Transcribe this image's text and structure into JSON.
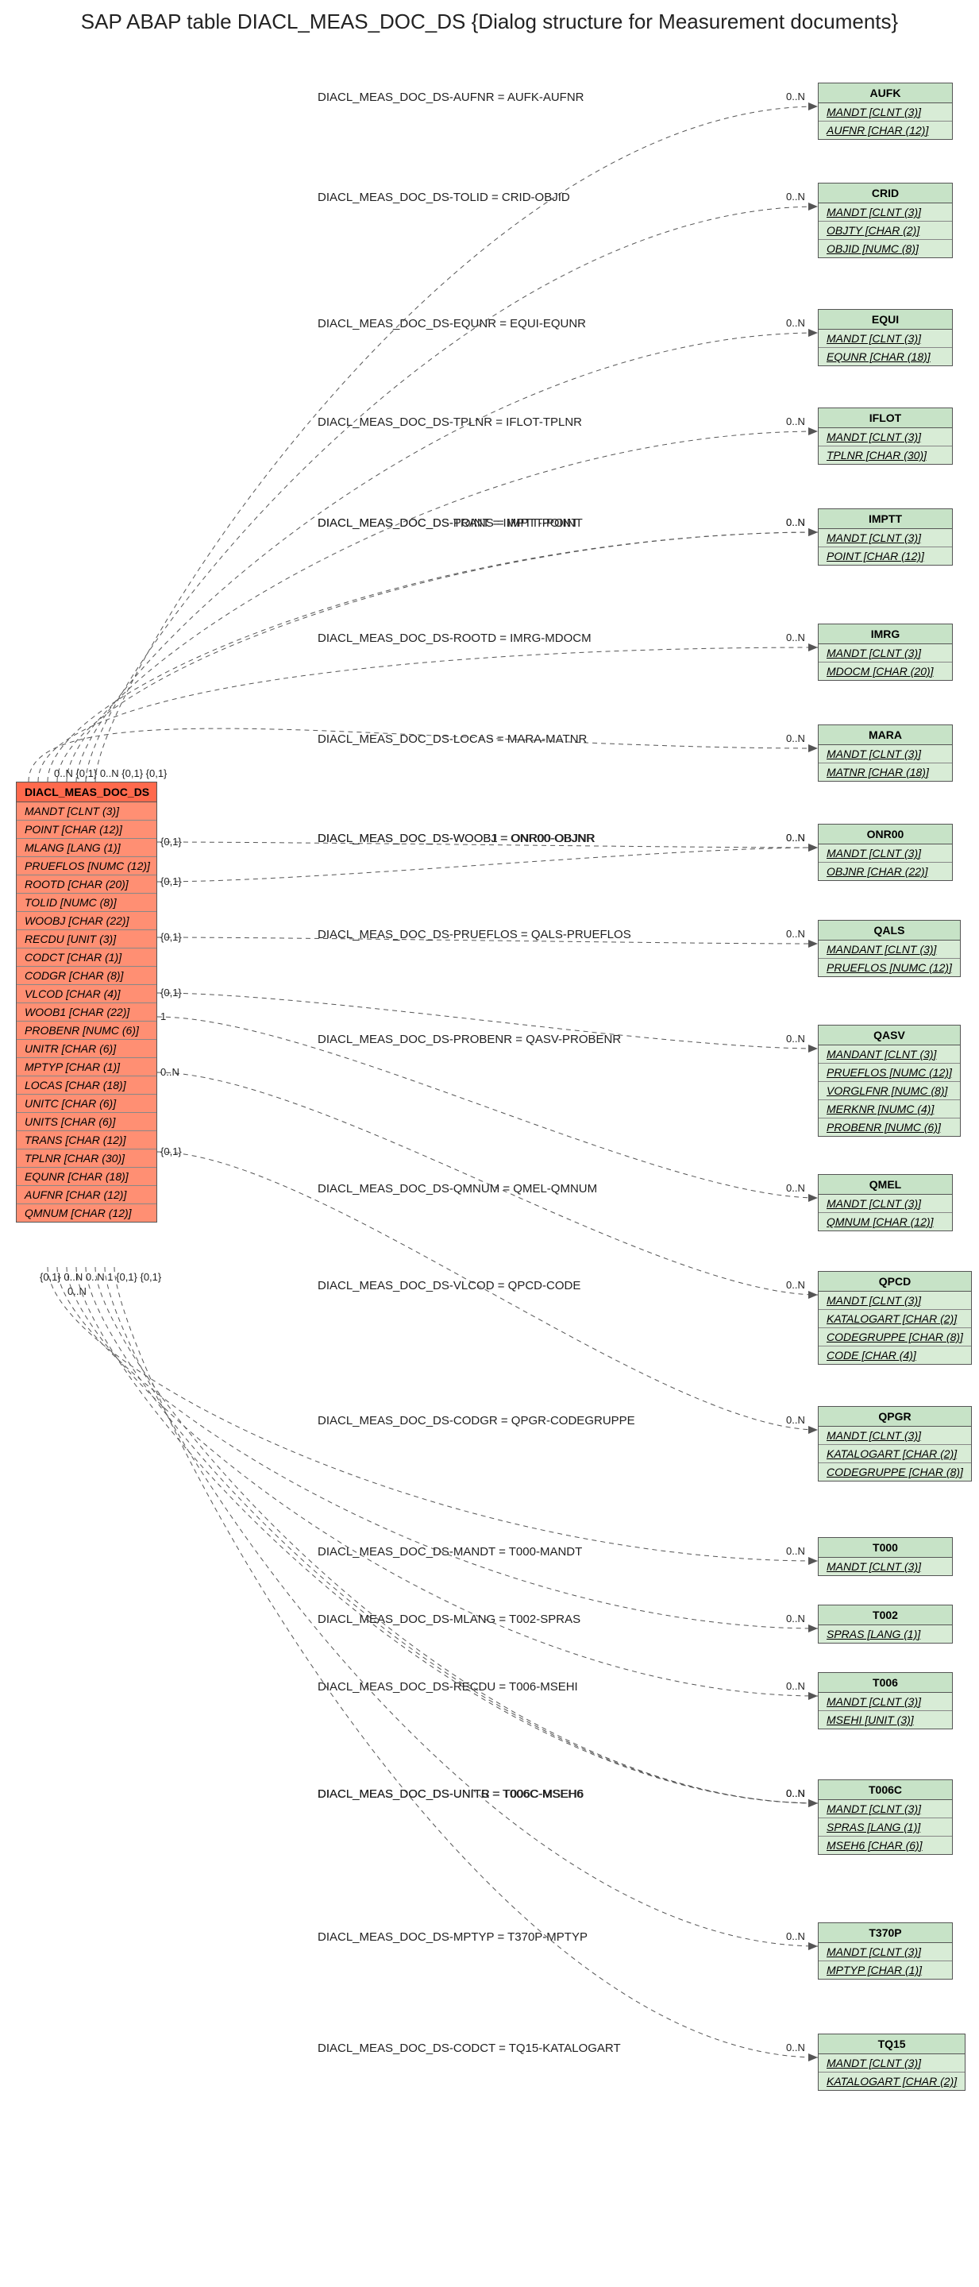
{
  "title": "SAP ABAP table DIACL_MEAS_DOC_DS {Dialog structure for Measurement documents}",
  "main": {
    "name": "DIACL_MEAS_DOC_DS",
    "fields": [
      "MANDT [CLNT (3)]",
      "POINT [CHAR (12)]",
      "MLANG [LANG (1)]",
      "PRUEFLOS [NUMC (12)]",
      "ROOTD [CHAR (20)]",
      "TOLID [NUMC (8)]",
      "WOOBJ [CHAR (22)]",
      "RECDU [UNIT (3)]",
      "CODCT [CHAR (1)]",
      "CODGR [CHAR (8)]",
      "VLCOD [CHAR (4)]",
      "WOOB1 [CHAR (22)]",
      "PROBENR [NUMC (6)]",
      "UNITR [CHAR (6)]",
      "MPTYP [CHAR (1)]",
      "LOCAS [CHAR (18)]",
      "UNITC [CHAR (6)]",
      "UNITS [CHAR (6)]",
      "TRANS [CHAR (12)]",
      "TPLNR [CHAR (30)]",
      "EQUNR [CHAR (18)]",
      "AUFNR [CHAR (12)]",
      "QMNUM [CHAR (12)]"
    ]
  },
  "targets": [
    {
      "name": "AUFK",
      "fields": [
        {
          "t": "MANDT [CLNT (3)]",
          "u": true
        },
        {
          "t": "AUFNR [CHAR (12)]",
          "u": true
        }
      ]
    },
    {
      "name": "CRID",
      "fields": [
        {
          "t": "MANDT [CLNT (3)]",
          "u": true
        },
        {
          "t": "OBJTY [CHAR (2)]",
          "u": true
        },
        {
          "t": "OBJID [NUMC (8)]",
          "u": true
        }
      ]
    },
    {
      "name": "EQUI",
      "fields": [
        {
          "t": "MANDT [CLNT (3)]",
          "u": true
        },
        {
          "t": "EQUNR [CHAR (18)]",
          "u": true
        }
      ]
    },
    {
      "name": "IFLOT",
      "fields": [
        {
          "t": "MANDT [CLNT (3)]",
          "u": true
        },
        {
          "t": "TPLNR [CHAR (30)]",
          "u": true
        }
      ]
    },
    {
      "name": "IMPTT",
      "fields": [
        {
          "t": "MANDT [CLNT (3)]",
          "u": true
        },
        {
          "t": "POINT [CHAR (12)]",
          "u": true
        }
      ]
    },
    {
      "name": "IMRG",
      "fields": [
        {
          "t": "MANDT [CLNT (3)]",
          "u": true
        },
        {
          "t": "MDOCM [CHAR (20)]",
          "u": true
        }
      ]
    },
    {
      "name": "MARA",
      "fields": [
        {
          "t": "MANDT [CLNT (3)]",
          "u": true
        },
        {
          "t": "MATNR [CHAR (18)]",
          "u": true
        }
      ]
    },
    {
      "name": "ONR00",
      "fields": [
        {
          "t": "MANDT [CLNT (3)]",
          "u": true
        },
        {
          "t": "OBJNR [CHAR (22)]",
          "u": true
        }
      ]
    },
    {
      "name": "QALS",
      "fields": [
        {
          "t": "MANDANT [CLNT (3)]",
          "u": true
        },
        {
          "t": "PRUEFLOS [NUMC (12)]",
          "u": true
        }
      ]
    },
    {
      "name": "QASV",
      "fields": [
        {
          "t": "MANDANT [CLNT (3)]",
          "u": true
        },
        {
          "t": "PRUEFLOS [NUMC (12)]",
          "u": true
        },
        {
          "t": "VORGLFNR [NUMC (8)]",
          "u": true
        },
        {
          "t": "MERKNR [NUMC (4)]",
          "u": true
        },
        {
          "t": "PROBENR [NUMC (6)]",
          "u": true
        }
      ]
    },
    {
      "name": "QMEL",
      "fields": [
        {
          "t": "MANDT [CLNT (3)]",
          "u": true
        },
        {
          "t": "QMNUM [CHAR (12)]",
          "u": true
        }
      ]
    },
    {
      "name": "QPCD",
      "fields": [
        {
          "t": "MANDT [CLNT (3)]",
          "u": true
        },
        {
          "t": "KATALOGART [CHAR (2)]",
          "u": true
        },
        {
          "t": "CODEGRUPPE [CHAR (8)]",
          "u": true
        },
        {
          "t": "CODE [CHAR (4)]",
          "u": true
        }
      ]
    },
    {
      "name": "QPGR",
      "fields": [
        {
          "t": "MANDT [CLNT (3)]",
          "u": true
        },
        {
          "t": "KATALOGART [CHAR (2)]",
          "u": true
        },
        {
          "t": "CODEGRUPPE [CHAR (8)]",
          "u": true
        }
      ]
    },
    {
      "name": "T000",
      "fields": [
        {
          "t": "MANDT [CLNT (3)]",
          "u": true
        }
      ]
    },
    {
      "name": "T002",
      "fields": [
        {
          "t": "SPRAS [LANG (1)]",
          "u": true
        }
      ]
    },
    {
      "name": "T006",
      "fields": [
        {
          "t": "MANDT [CLNT (3)]",
          "u": true
        },
        {
          "t": "MSEHI [UNIT (3)]",
          "u": true
        }
      ]
    },
    {
      "name": "T006C",
      "fields": [
        {
          "t": "MANDT [CLNT (3)]",
          "u": true
        },
        {
          "t": "SPRAS [LANG (1)]",
          "u": true
        },
        {
          "t": "MSEH6 [CHAR (6)]",
          "u": true
        }
      ]
    },
    {
      "name": "T370P",
      "fields": [
        {
          "t": "MANDT [CLNT (3)]",
          "u": true
        },
        {
          "t": "MPTYP [CHAR (1)]",
          "u": true
        }
      ]
    },
    {
      "name": "TQ15",
      "fields": [
        {
          "t": "MANDT [CLNT (3)]",
          "u": true
        },
        {
          "t": "KATALOGART [CHAR (2)]",
          "u": true
        }
      ]
    }
  ],
  "edges": [
    {
      "label": "DIACL_MEAS_DOC_DS-AUFNR = AUFK-AUFNR",
      "src_card": "0..N",
      "dst_card": "0..N"
    },
    {
      "label": "DIACL_MEAS_DOC_DS-TOLID = CRID-OBJID",
      "src_card": "{0,1}",
      "dst_card": "0..N"
    },
    {
      "label": "DIACL_MEAS_DOC_DS-EQUNR = EQUI-EQUNR",
      "src_card": "0..N",
      "dst_card": "0..N"
    },
    {
      "label": "DIACL_MEAS_DOC_DS-TPLNR = IFLOT-TPLNR",
      "src_card": "{0,1}",
      "dst_card": "0..N"
    },
    {
      "label": "DIACL_MEAS_DOC_DS-POINT = IMPTT-POINT",
      "src_card": "{0,1}",
      "dst_card": "0..N"
    },
    {
      "label": "DIACL_MEAS_DOC_DS-TRANS = IMPTT-POINT",
      "src_card": "",
      "dst_card": "0..N"
    },
    {
      "label": "DIACL_MEAS_DOC_DS-ROOTD = IMRG-MDOCM",
      "src_card": "",
      "dst_card": "0..N"
    },
    {
      "label": "DIACL_MEAS_DOC_DS-LOCAS = MARA-MATNR",
      "src_card": "",
      "dst_card": "0..N"
    },
    {
      "label": "DIACL_MEAS_DOC_DS-WOOB1 = ONR00-OBJNR",
      "src_card": "{0,1}",
      "dst_card": "0..N"
    },
    {
      "label": "DIACL_MEAS_DOC_DS-WOOBJ = ONR00-OBJNR",
      "src_card": "{0,1}",
      "dst_card": "0..N"
    },
    {
      "label": "DIACL_MEAS_DOC_DS-PRUEFLOS = QALS-PRUEFLOS",
      "src_card": "{0,1}",
      "dst_card": "0..N"
    },
    {
      "label": "DIACL_MEAS_DOC_DS-PROBENR = QASV-PROBENR",
      "src_card": "{0,1}",
      "dst_card": "0..N"
    },
    {
      "label": "DIACL_MEAS_DOC_DS-QMNUM = QMEL-QMNUM",
      "src_card": "1",
      "dst_card": "0..N"
    },
    {
      "label": "DIACL_MEAS_DOC_DS-VLCOD = QPCD-CODE",
      "src_card": "0..N",
      "dst_card": "0..N"
    },
    {
      "label": "DIACL_MEAS_DOC_DS-CODGR = QPGR-CODEGRUPPE",
      "src_card": "{0,1}",
      "dst_card": "0..N"
    },
    {
      "label": "DIACL_MEAS_DOC_DS-MANDT = T000-MANDT",
      "src_card": "{0,1}",
      "dst_card": "0..N"
    },
    {
      "label": "DIACL_MEAS_DOC_DS-MLANG = T002-SPRAS",
      "src_card": "0..N",
      "dst_card": "0..N"
    },
    {
      "label": "DIACL_MEAS_DOC_DS-RECDU = T006-MSEHI",
      "src_card": "0..N",
      "dst_card": "0..N"
    },
    {
      "label": "DIACL_MEAS_DOC_DS-UNITC = T006C-MSEH6",
      "src_card": "1",
      "dst_card": "0..N"
    },
    {
      "label": "DIACL_MEAS_DOC_DS-UNITR = T006C-MSEH6",
      "src_card": "{0,1}",
      "dst_card": "0..N"
    },
    {
      "label": "DIACL_MEAS_DOC_DS-UNITS = T006C-MSEH6",
      "src_card": "{0,1}",
      "dst_card": "0..N"
    },
    {
      "label": "DIACL_MEAS_DOC_DS-MPTYP = T370P-MPTYP",
      "src_card": "",
      "dst_card": "0..N"
    },
    {
      "label": "DIACL_MEAS_DOC_DS-CODCT = TQ15-KATALOGART",
      "src_card": "0..N",
      "dst_card": "0..N"
    }
  ],
  "srcCardCluster": "0..N {0,1} 0..N {0,1} {0,1}",
  "srcCardClusterB": "{0,1} 0..N 0..N 1 {0,1} {0,1}",
  "srcCardClusterC": "0..N"
}
